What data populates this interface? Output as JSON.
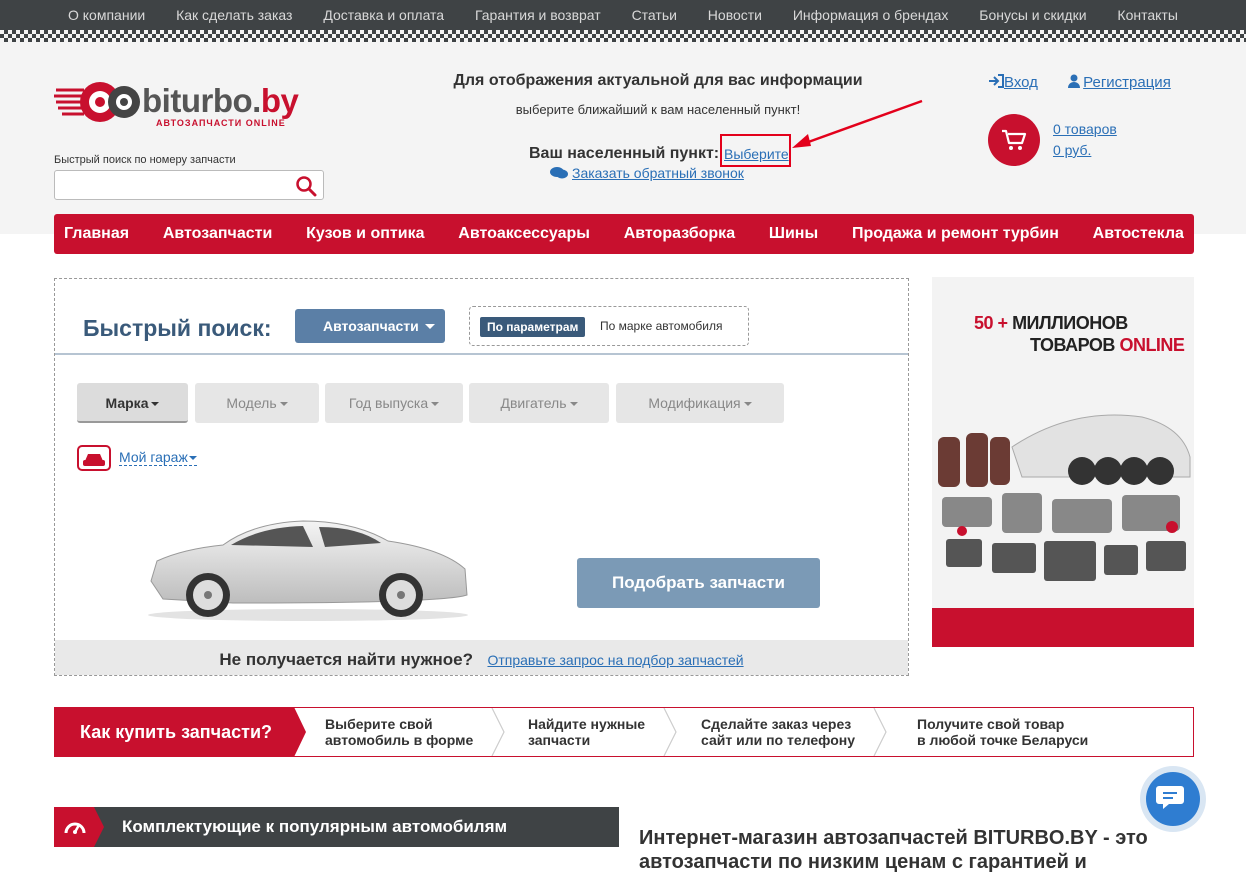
{
  "topnav": [
    "О компании",
    "Как сделать заказ",
    "Доставка и оплата",
    "Гарантия и возврат",
    "Статьи",
    "Новости",
    "Информация о брендах",
    "Бонусы и скидки",
    "Контакты"
  ],
  "logo": {
    "brand_main": "biturbo.",
    "brand_by": "by",
    "tagline": "АВТОЗАПЧАСТИ ONLINE"
  },
  "search": {
    "label": "Быстрый поиск по номеру запчасти",
    "value": "",
    "placeholder": ""
  },
  "location": {
    "line1": "Для отображения актуальной для вас информации",
    "line2": "выберите ближайший к вам населенный пункт!",
    "city_label": "Ваш населенный пункт:",
    "city_link": "Выберите",
    "callback": "Заказать обратный звонок"
  },
  "auth": {
    "login": "Вход",
    "register": "Регистрация"
  },
  "cart": {
    "items": "0 товаров",
    "sum": "0 руб."
  },
  "mainmenu": [
    "Главная",
    "Автозапчасти",
    "Кузов и оптика",
    "Автоаксессуары",
    "Авторазборка",
    "Шины",
    "Продажа и ремонт турбин",
    "Автостекла"
  ],
  "quick_search": {
    "title": "Быстрый поиск:",
    "category": "Автозапчасти",
    "mode_active": "По параметрам",
    "mode_inactive": "По марке автомобиля",
    "filters": [
      "Марка",
      "Модель",
      "Год выпуска",
      "Двигатель",
      "Модификация"
    ],
    "garage": "Мой гараж",
    "pick_button": "Подобрать запчасти",
    "footer_question": "Не получается найти нужное?",
    "footer_link": "Отправьте запрос на подбор запчастей"
  },
  "banner": {
    "num": "50 +",
    "line1": "МИЛЛИОНОВ",
    "line2a": "ТОВАРОВ",
    "line2b": "ONLINE"
  },
  "howto": {
    "title": "Как купить запчасти?",
    "steps": [
      [
        "Выберите свой",
        "автомобиль в форме"
      ],
      [
        "Найдите нужные",
        "запчасти"
      ],
      [
        "Сделайте заказ через",
        "сайт или по телефону"
      ],
      [
        "Получите свой товар",
        "в любой точке Беларуси"
      ]
    ]
  },
  "popular": {
    "title": "Комплектующие к популярным автомобилям"
  },
  "seo": {
    "line1": "Интернет-магазин автозапчастей BITURBO.BY - это",
    "line2": "автозапчасти по низким ценам с гарантией и"
  },
  "colors": {
    "brand_red": "#c8102e",
    "dark": "#3f4345",
    "link": "#2a6fb6",
    "accent_blue": "#5b7fa6"
  }
}
